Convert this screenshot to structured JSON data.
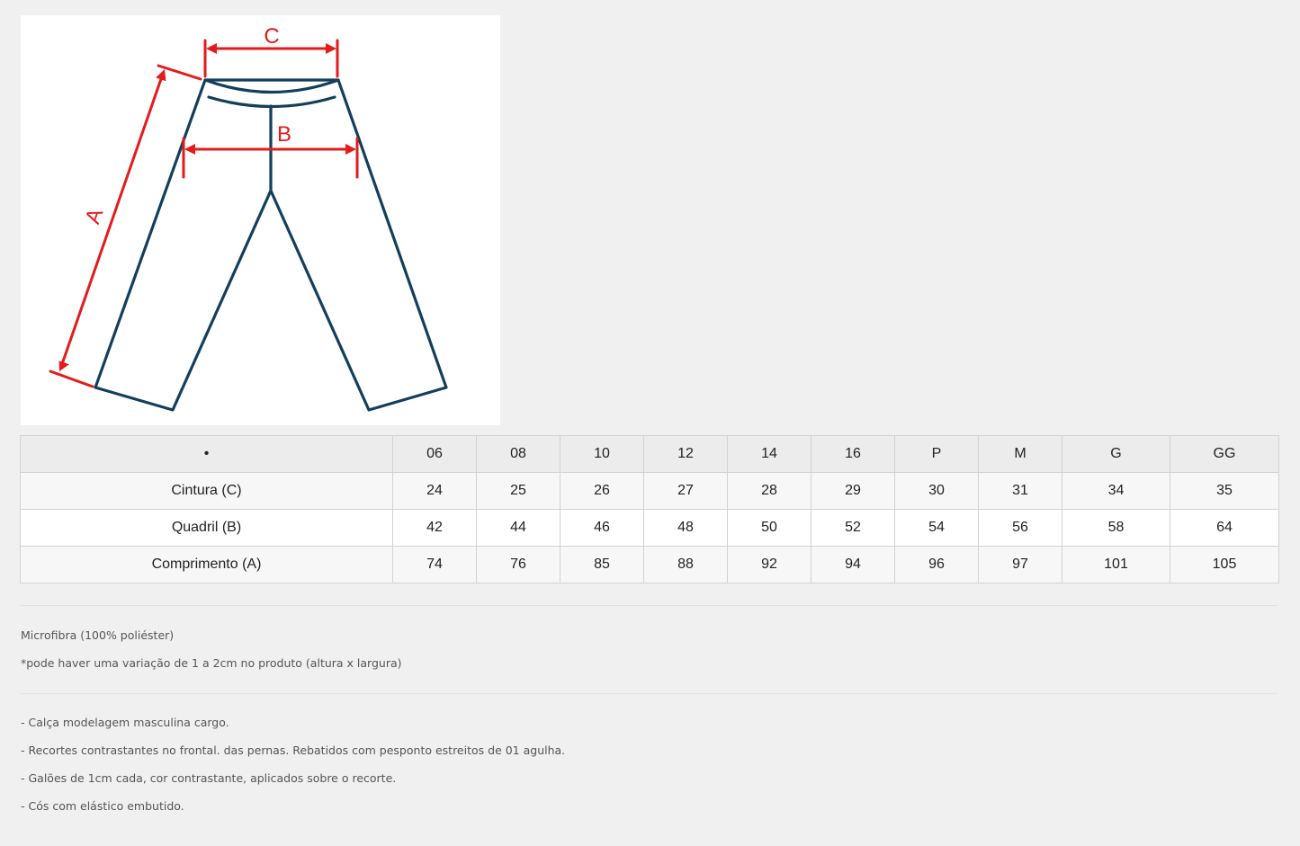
{
  "diagram": {
    "labels": {
      "a": "A",
      "b": "B",
      "c": "C"
    },
    "colors": {
      "outline": "#123f5c",
      "measure": "#e41b1b"
    }
  },
  "size_table": {
    "header": [
      "•",
      "06",
      "08",
      "10",
      "12",
      "14",
      "16",
      "P",
      "M",
      "G",
      "GG"
    ],
    "rows": [
      [
        "Cintura (C)",
        "24",
        "25",
        "26",
        "27",
        "28",
        "29",
        "30",
        "31",
        "34",
        "35"
      ],
      [
        "Quadril (B)",
        "42",
        "44",
        "46",
        "48",
        "50",
        "52",
        "54",
        "56",
        "58",
        "64"
      ],
      [
        "Comprimento (A)",
        "74",
        "76",
        "85",
        "88",
        "92",
        "94",
        "96",
        "97",
        "101",
        "105"
      ]
    ]
  },
  "material": {
    "fabric": "Microfibra (100% poliéster)",
    "variation_note": "*pode haver uma variação de 1 a 2cm no produto (altura x largura)"
  },
  "features": [
    "- Calça modelagem masculina cargo.",
    "- Recortes contrastantes no frontal. das pernas. Rebatidos com pesponto estreitos de 01 agulha.",
    "- Galões de 1cm cada,  cor contrastante, aplicados sobre o recorte.",
    "- Cós com elástico embutido."
  ]
}
